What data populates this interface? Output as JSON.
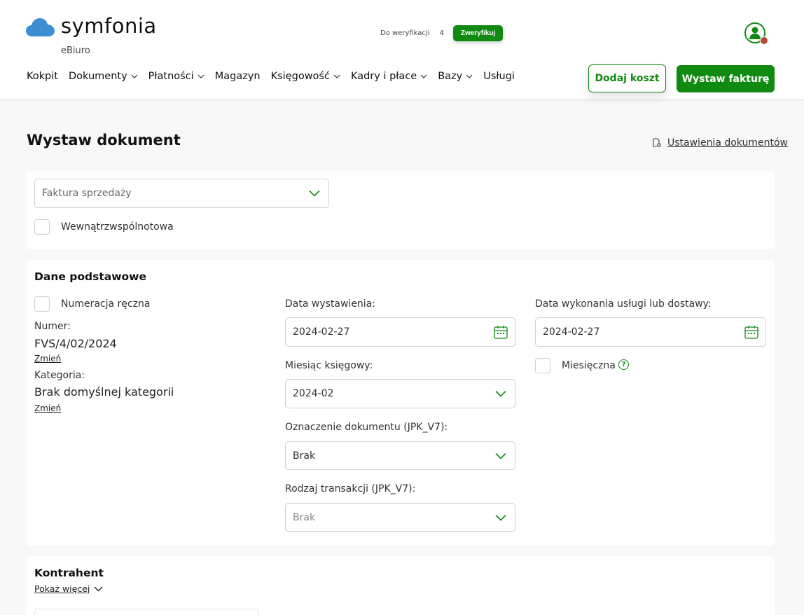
{
  "brand": {
    "name": "symfonia",
    "subtitle": "eBiuro",
    "accent": "#108a10",
    "cloud_color": "#3c8ed4"
  },
  "verification": {
    "label": "Do weryfikacji",
    "count": "4",
    "button": "Zweryfikuj"
  },
  "nav": {
    "items": [
      {
        "label": "Kokpit",
        "dropdown": false
      },
      {
        "label": "Dokumenty",
        "dropdown": true
      },
      {
        "label": "Płatności",
        "dropdown": true
      },
      {
        "label": "Magazyn",
        "dropdown": false
      },
      {
        "label": "Księgowość",
        "dropdown": true
      },
      {
        "label": "Kadry i płace",
        "dropdown": true
      },
      {
        "label": "Bazy",
        "dropdown": true
      },
      {
        "label": "Usługi",
        "dropdown": false
      }
    ]
  },
  "actions": {
    "add_cost": "Dodaj koszt",
    "issue_invoice": "Wystaw fakturę"
  },
  "page": {
    "title": "Wystaw dokument",
    "settings_link": " Ustawienia dokumentów"
  },
  "doc_type": {
    "selected": "Faktura sprzedaży",
    "intra_community_label": "Wewnątrzwspólnotowa"
  },
  "basic": {
    "title": "Dane podstawowe",
    "manual_numbering_label": "Numeracja ręczna",
    "number_label": "Numer:",
    "number_value": "FVS/4/02/2024",
    "change_label": "Zmień",
    "category_label": "Kategoria:",
    "category_value": "Brak domyślnej kategorii",
    "issue_date_label": "Data wystawienia:",
    "issue_date_value": "2024-02-27",
    "accounting_month_label": "Miesiąc księgowy:",
    "accounting_month_value": "2024-02",
    "doc_marking_label": "Oznaczenie dokumentu (JPK_V7):",
    "doc_marking_value": "Brak",
    "transaction_type_label": "Rodzaj transakcji (JPK_V7):",
    "transaction_type_value": "Brak",
    "service_date_label": "Data wykonania usługi lub dostawy:",
    "service_date_value": "2024-02-27",
    "monthly_label": "Miesięczna",
    "help_symbol": "?"
  },
  "contractor": {
    "title": "Kontrahent",
    "show_more": "Pokaż więcej"
  }
}
